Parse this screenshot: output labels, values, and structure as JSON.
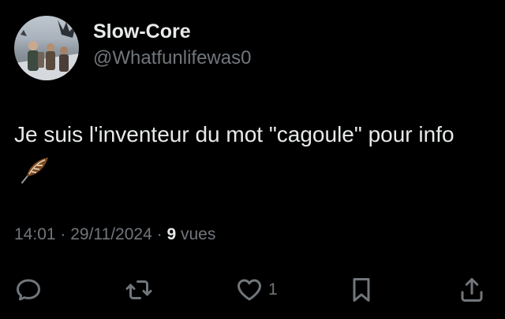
{
  "author": {
    "display_name": "Slow-Core",
    "handle": "@Whatfunlifewas0",
    "avatar": "avatar-image"
  },
  "tweet": {
    "text": "Je suis l'inventeur du mot \"cagoule\" pour info",
    "emoji": "feather-icon"
  },
  "meta": {
    "time": "14:01",
    "separator": " · ",
    "date": "29/11/2024",
    "views_count": "9",
    "views_label": " vues"
  },
  "actions": {
    "reply_icon": "reply-icon",
    "retweet_icon": "retweet-icon",
    "like_icon": "heart-icon",
    "like_count": "1",
    "bookmark_icon": "bookmark-icon",
    "share_icon": "share-icon"
  },
  "colors": {
    "background": "#000000",
    "primary_text": "#e7e9ea",
    "secondary_text": "#71767b"
  }
}
